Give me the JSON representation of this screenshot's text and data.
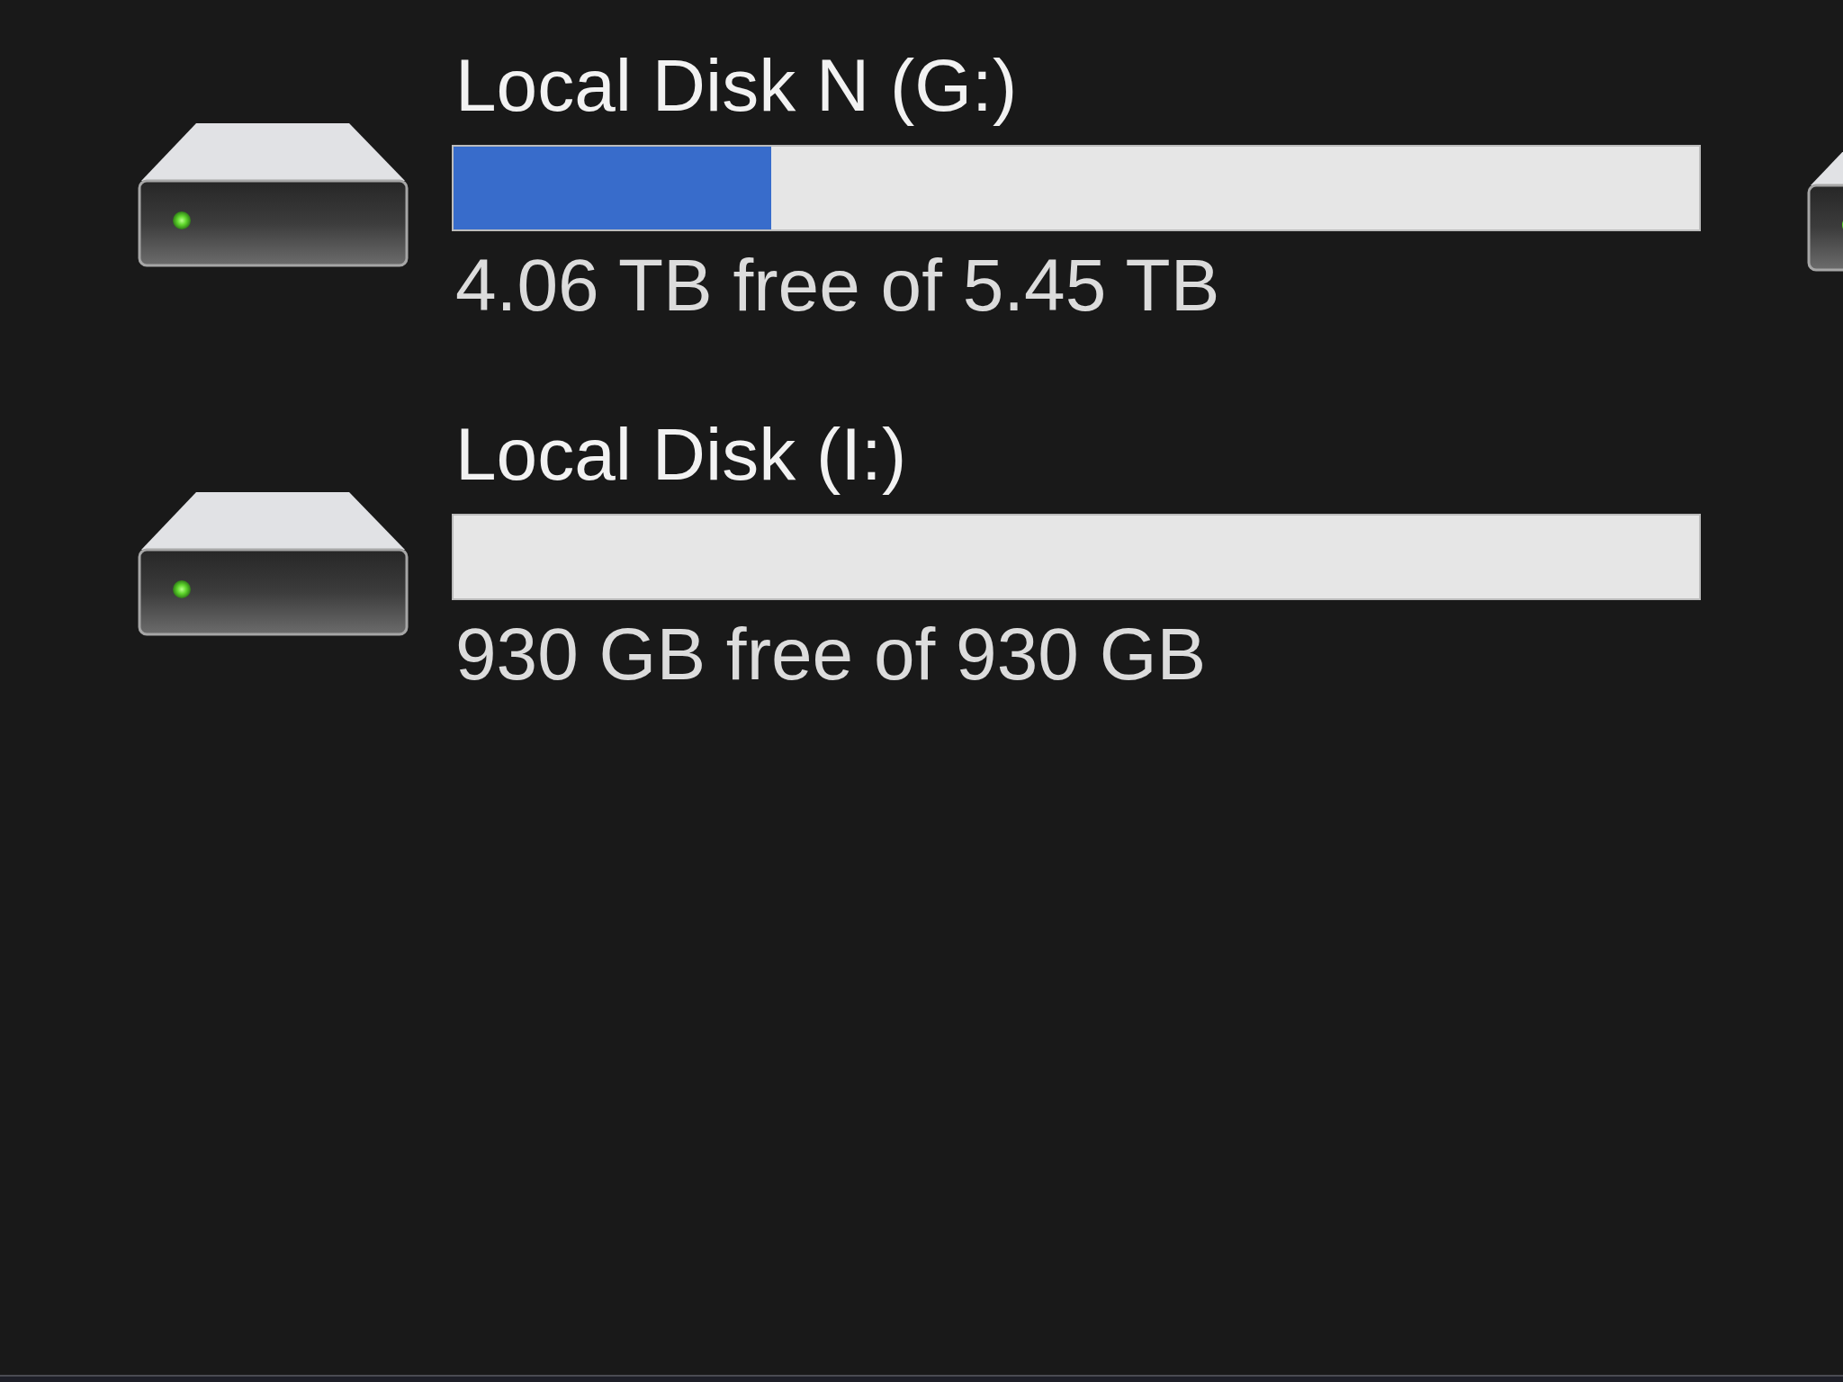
{
  "drives": [
    {
      "name": "Local Disk N (G:)",
      "level": 0.255,
      "free_text": "4.06 TB free of 5.45 TB"
    },
    {
      "name": "Local Disk (I:)",
      "free_text": "930 GB free of 930 GB"
    }
  ]
}
